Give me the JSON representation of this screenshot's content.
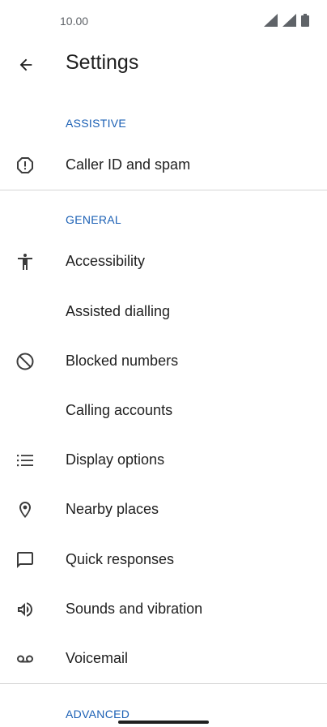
{
  "status_bar": {
    "time": "10.00"
  },
  "app_bar": {
    "title": "Settings"
  },
  "sections": {
    "assistive": "ASSISTIVE",
    "general": "GENERAL",
    "advanced": "ADVANCED"
  },
  "items": {
    "caller_id": {
      "label": "Caller ID and spam",
      "icon": "alert-octagon-icon"
    },
    "accessibility": {
      "label": "Accessibility",
      "icon": "accessibility-icon"
    },
    "assisted_dialling": {
      "label": "Assisted dialling"
    },
    "blocked_numbers": {
      "label": "Blocked numbers",
      "icon": "block-icon"
    },
    "calling_accounts": {
      "label": "Calling accounts"
    },
    "display_options": {
      "label": "Display options",
      "icon": "list-icon"
    },
    "nearby_places": {
      "label": "Nearby places",
      "icon": "location-pin-icon"
    },
    "quick_responses": {
      "label": "Quick responses",
      "icon": "chat-bubble-icon"
    },
    "sounds_vibration": {
      "label": "Sounds and vibration",
      "icon": "volume-icon"
    },
    "voicemail": {
      "label": "Voicemail",
      "icon": "voicemail-icon"
    }
  },
  "colors": {
    "accent": "#1a5fb4",
    "text": "#1f1f1f",
    "icon": "#3c3c3c",
    "divider": "#d6d6d6"
  }
}
